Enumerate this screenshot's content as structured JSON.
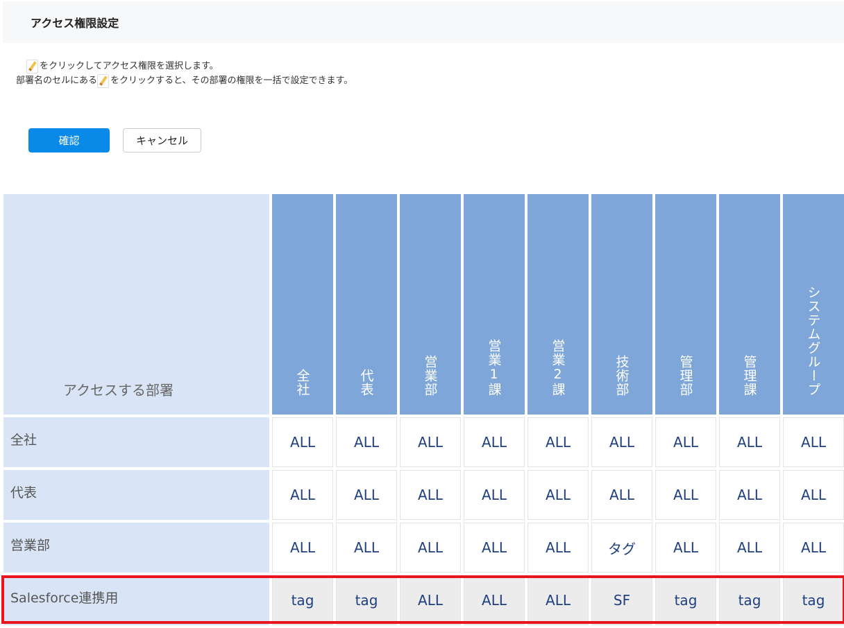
{
  "page": {
    "title": "アクセス権限設定"
  },
  "help": {
    "line1": "をクリックしてアクセス権限を選択します。",
    "line2_before": "部署名のセルにある",
    "line2_after": "をクリックすると、その部署の権限を一括で設定できます。"
  },
  "buttons": {
    "confirm": "確認",
    "cancel": "キャンセル"
  },
  "colors": {
    "confirm": "#0a8ae8",
    "header": "#7fa6d8",
    "rowHeader": "#d9e5f6",
    "highlight": "#e8141e"
  },
  "table": {
    "corner_label": "アクセスする部署",
    "columns": [
      "全社",
      "代表",
      "営業部",
      "営業1課",
      "営業2課",
      "技術部",
      "管理部",
      "管理課",
      "システムグループ"
    ],
    "rows": [
      {
        "label": "全社",
        "values": [
          "ALL",
          "ALL",
          "ALL",
          "ALL",
          "ALL",
          "ALL",
          "ALL",
          "ALL",
          "ALL"
        ]
      },
      {
        "label": "代表",
        "values": [
          "ALL",
          "ALL",
          "ALL",
          "ALL",
          "ALL",
          "ALL",
          "ALL",
          "ALL",
          "ALL"
        ]
      },
      {
        "label": "営業部",
        "values": [
          "ALL",
          "ALL",
          "ALL",
          "ALL",
          "ALL",
          "タグ",
          "ALL",
          "ALL",
          "ALL"
        ]
      },
      {
        "label": "Salesforce連携用",
        "values": [
          "tag",
          "tag",
          "ALL",
          "ALL",
          "ALL",
          "SF",
          "tag",
          "tag",
          "tag"
        ]
      }
    ]
  }
}
